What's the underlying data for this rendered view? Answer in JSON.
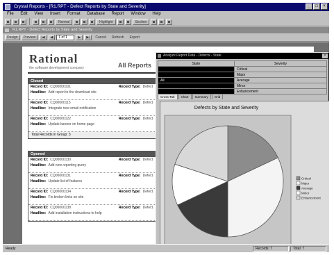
{
  "window": {
    "title": "Crystal Reports - [R1.RPT - Defect Reports by State and Severity]",
    "controls": [
      "_",
      "□",
      "×"
    ]
  },
  "menu": [
    "File",
    "Edit",
    "View",
    "Insert",
    "Format",
    "Database",
    "Report",
    "Window",
    "Help"
  ],
  "toolbar": {
    "labels": [
      "Normal",
      "Highlight",
      "Section"
    ]
  },
  "child_window": {
    "title": "R1.RPT - Defect Reports by State and Severity"
  },
  "nav": {
    "tabs": [
      "Design",
      "Preview"
    ],
    "page": "1 of 1",
    "cancel_label": "Cancel",
    "refresh_label": "Refresh",
    "export_label": "Export",
    "arrows": [
      "|◀",
      "◀",
      "▶",
      "▶|"
    ]
  },
  "report": {
    "logo": "Rational",
    "logo_sub": "the software development company",
    "title": "All Reports",
    "sections": [
      {
        "name": "Closed",
        "records": [
          {
            "id_label": "Record ID:",
            "id": "CQ00000101",
            "type_label": "Record Type:",
            "type": "Defect",
            "headline_label": "Headline:",
            "headline": "Add report to the download site"
          },
          {
            "id_label": "Record ID:",
            "id": "CQ00000115",
            "type_label": "Record Type:",
            "type": "Defect",
            "headline_label": "Headline:",
            "headline": "Integrate new email notification"
          },
          {
            "id_label": "Record ID:",
            "id": "CQ00000122",
            "type_label": "Record Type:",
            "type": "Defect",
            "headline_label": "Headline:",
            "headline": "Update banner on home page"
          }
        ],
        "total_label": "Total Records in Group: 3"
      },
      {
        "name": "Opened",
        "records": [
          {
            "id_label": "Record ID:",
            "id": "CQ00000130",
            "type_label": "Record Type:",
            "type": "Defect",
            "headline_label": "Headline:",
            "headline": "Add new reporting query"
          },
          {
            "id_label": "Record ID:",
            "id": "CQ00000131",
            "type_label": "Record Type:",
            "type": "Defect",
            "headline_label": "Headline:",
            "headline": "Update list of features"
          },
          {
            "id_label": "Record ID:",
            "id": "CQ00000134",
            "type_label": "Record Type:",
            "type": "Defect",
            "headline_label": "Headline:",
            "headline": "Fix broken links on site"
          },
          {
            "id_label": "Record ID:",
            "id": "CQ00000138",
            "type_label": "Record Type:",
            "type": "Defect",
            "headline_label": "Headline:",
            "headline": "Add installation instructions to help"
          }
        ]
      }
    ]
  },
  "grid_window": {
    "title": "Analyze Report Data - Defects - State",
    "columns": [
      "State",
      "Severity"
    ],
    "rows": [
      {
        "state": "",
        "severity": "Critical"
      },
      {
        "state": "",
        "severity": "Major"
      },
      {
        "state": "All",
        "severity": "Average"
      },
      {
        "state": "",
        "severity": "Minor"
      },
      {
        "state": "",
        "severity": "Enhancement"
      }
    ]
  },
  "tabs": [
    "Cross-Tab",
    "Chart",
    "Summary",
    "Grid"
  ],
  "chart_data": {
    "type": "pie",
    "title": "Defects by State and Severity",
    "categories": [
      "Critical",
      "Major",
      "Average",
      "Minor",
      "Enhancement"
    ],
    "values": [
      18,
      32,
      18,
      12,
      20
    ],
    "colors": [
      "#8c8c8c",
      "#f4f4f4",
      "#3a3a3a",
      "#ffffff",
      "#d8d8d8"
    ],
    "legend_position": "right"
  },
  "status": {
    "left": "Ready",
    "records": "Records: 7",
    "total": "Total: 7"
  }
}
